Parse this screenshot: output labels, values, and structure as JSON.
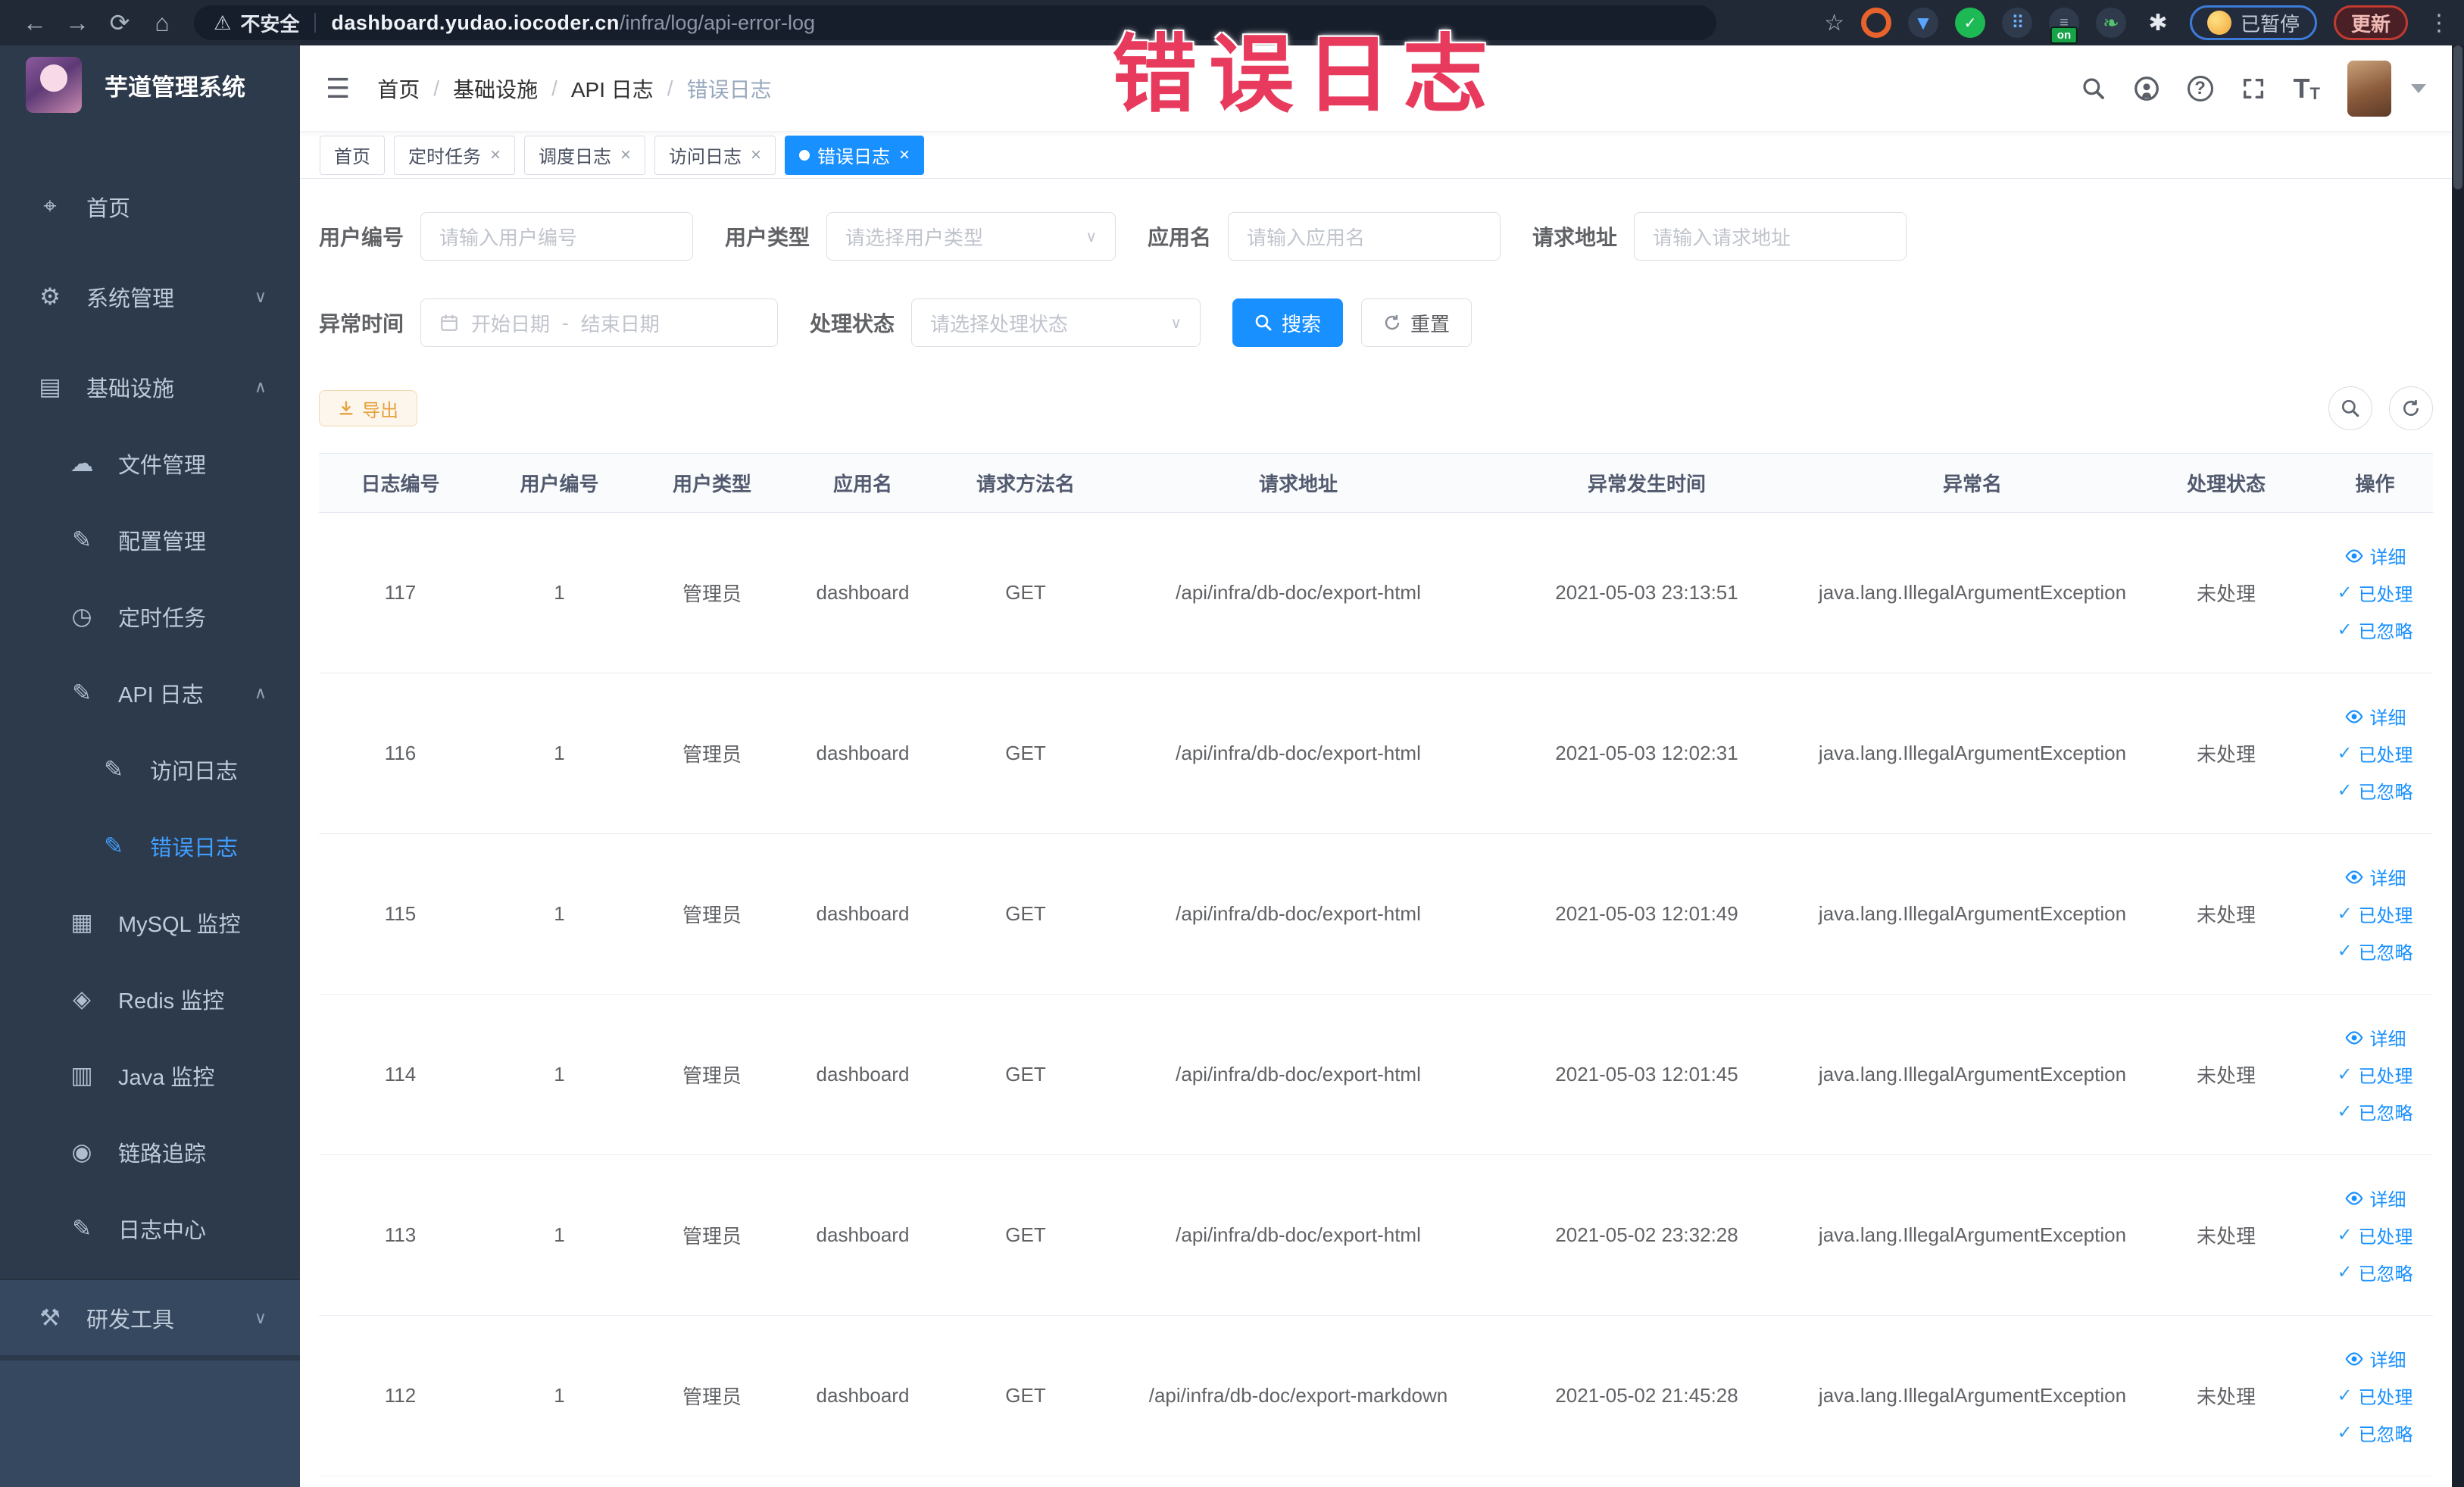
{
  "colors": {
    "accent": "#1890ff",
    "sidebar_bg": "#2d3a4b",
    "active_link": "#409eff",
    "warn_text": "#e6a23c",
    "annotation": "#e83a5c"
  },
  "browser": {
    "security_label": "不安全",
    "url_host": "dashboard.yudao.iocoder.cn",
    "url_path": "/infra/log/api-error-log",
    "extension_badge": "on",
    "paused_badge": "已暂停",
    "update_button": "更新"
  },
  "annotation": {
    "text": "错误日志"
  },
  "sidebar": {
    "title": "芋道管理系统",
    "items": [
      {
        "label": "首页",
        "icon": "dashboard",
        "level": 1
      },
      {
        "label": "系统管理",
        "icon": "system",
        "level": 1,
        "chevron": "down",
        "gap": true
      },
      {
        "label": "基础设施",
        "icon": "infra",
        "level": 1,
        "chevron": "up",
        "gap": true
      },
      {
        "label": "文件管理",
        "icon": "file",
        "level": 2
      },
      {
        "label": "配置管理",
        "icon": "config",
        "level": 2
      },
      {
        "label": "定时任务",
        "icon": "job",
        "level": 2
      },
      {
        "label": "API 日志",
        "icon": "api-log",
        "level": 2,
        "chevron": "up"
      },
      {
        "label": "访问日志",
        "icon": "access-log",
        "level": 3
      },
      {
        "label": "错误日志",
        "icon": "error-log",
        "level": 3,
        "active": true
      },
      {
        "label": "MySQL 监控",
        "icon": "mysql",
        "level": 2
      },
      {
        "label": "Redis 监控",
        "icon": "redis",
        "level": 2
      },
      {
        "label": "Java 监控",
        "icon": "java",
        "level": 2
      },
      {
        "label": "链路追踪",
        "icon": "trace",
        "level": 2
      },
      {
        "label": "日志中心",
        "icon": "log-center",
        "level": 2
      },
      {
        "label": "研发工具",
        "icon": "devtools",
        "level": 1,
        "chevron": "down",
        "light": true
      }
    ]
  },
  "breadcrumb": {
    "items": [
      "首页",
      "基础设施",
      "API 日志"
    ],
    "current": "错误日志"
  },
  "tabs": [
    {
      "label": "首页",
      "closable": false,
      "active": false
    },
    {
      "label": "定时任务",
      "closable": true,
      "active": false
    },
    {
      "label": "调度日志",
      "closable": true,
      "active": false
    },
    {
      "label": "访问日志",
      "closable": true,
      "active": false
    },
    {
      "label": "错误日志",
      "closable": true,
      "active": true
    }
  ],
  "filters": {
    "user_id": {
      "label": "用户编号",
      "placeholder": "请输入用户编号",
      "value": ""
    },
    "user_type": {
      "label": "用户类型",
      "placeholder": "请选择用户类型"
    },
    "app_name": {
      "label": "应用名",
      "placeholder": "请输入应用名",
      "value": ""
    },
    "request_url": {
      "label": "请求地址",
      "placeholder": "请输入请求地址",
      "value": ""
    },
    "exception_time": {
      "label": "异常时间",
      "start_placeholder": "开始日期",
      "separator": "-",
      "end_placeholder": "结束日期"
    },
    "process_status": {
      "label": "处理状态",
      "placeholder": "请选择处理状态"
    },
    "search_label": "搜索",
    "reset_label": "重置"
  },
  "toolbar": {
    "export_label": "导出"
  },
  "table": {
    "columns": [
      "日志编号",
      "用户编号",
      "用户类型",
      "应用名",
      "请求方法名",
      "请求地址",
      "异常发生时间",
      "异常名",
      "处理状态",
      "操作"
    ],
    "action_labels": [
      "详细",
      "已处理",
      "已忽略"
    ],
    "rows": [
      {
        "id": "117",
        "user_id": "1",
        "user_type": "管理员",
        "app_name": "dashboard",
        "method": "GET",
        "url": "/api/infra/db-doc/export-html",
        "time": "2021-05-03 23:13:51",
        "exception": "java.lang.IllegalArgumentException",
        "status": "未处理"
      },
      {
        "id": "116",
        "user_id": "1",
        "user_type": "管理员",
        "app_name": "dashboard",
        "method": "GET",
        "url": "/api/infra/db-doc/export-html",
        "time": "2021-05-03 12:02:31",
        "exception": "java.lang.IllegalArgumentException",
        "status": "未处理"
      },
      {
        "id": "115",
        "user_id": "1",
        "user_type": "管理员",
        "app_name": "dashboard",
        "method": "GET",
        "url": "/api/infra/db-doc/export-html",
        "time": "2021-05-03 12:01:49",
        "exception": "java.lang.IllegalArgumentException",
        "status": "未处理"
      },
      {
        "id": "114",
        "user_id": "1",
        "user_type": "管理员",
        "app_name": "dashboard",
        "method": "GET",
        "url": "/api/infra/db-doc/export-html",
        "time": "2021-05-03 12:01:45",
        "exception": "java.lang.IllegalArgumentException",
        "status": "未处理"
      },
      {
        "id": "113",
        "user_id": "1",
        "user_type": "管理员",
        "app_name": "dashboard",
        "method": "GET",
        "url": "/api/infra/db-doc/export-html",
        "time": "2021-05-02 23:32:28",
        "exception": "java.lang.IllegalArgumentException",
        "status": "未处理"
      },
      {
        "id": "112",
        "user_id": "1",
        "user_type": "管理员",
        "app_name": "dashboard",
        "method": "GET",
        "url": "/api/infra/db-doc/export-markdown",
        "time": "2021-05-02 21:45:28",
        "exception": "java.lang.IllegalArgumentException",
        "status": "未处理"
      }
    ]
  }
}
